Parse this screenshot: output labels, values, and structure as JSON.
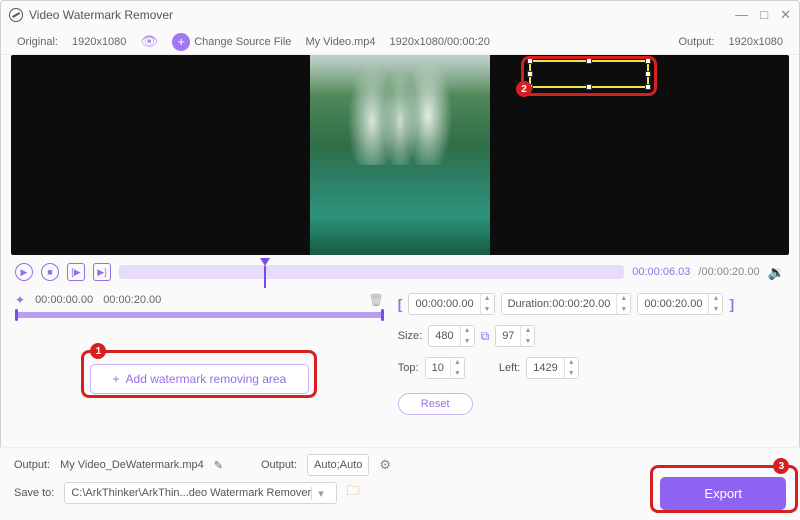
{
  "app_title": "Video Watermark Remover",
  "window": {
    "min": "—",
    "max": "□",
    "close": "✕"
  },
  "infobar": {
    "original_label": "Original:",
    "original_res": "1920x1080",
    "change_source": "Change Source File",
    "filename": "My Video.mp4",
    "src_info": "1920x1080/00:00:20",
    "output_label": "Output:",
    "output_res": "1920x1080"
  },
  "transport": {
    "current": "00:00:06.03",
    "duration": "/00:00:20.00"
  },
  "segment": {
    "start": "00:00:00.00",
    "end": "00:00:20.00"
  },
  "add_area_label": "Add watermark removing area",
  "region": {
    "range_start": "00:00:00.00",
    "duration_label": "Duration:00:00:20.00",
    "range_end": "00:00:20.00",
    "size_label": "Size:",
    "width": "480",
    "height": "97",
    "top_label": "Top:",
    "top": "10",
    "left_label": "Left:",
    "left": "1429",
    "reset": "Reset"
  },
  "bottom": {
    "output_label": "Output:",
    "output_name": "My Video_DeWatermark.mp4",
    "output2_label": "Output:",
    "output2_value": "Auto;Auto",
    "save_label": "Save to:",
    "save_path": "C:\\ArkThinker\\ArkThin...deo Watermark Remover"
  },
  "export_label": "Export",
  "callouts": {
    "c1": "1",
    "c2": "2",
    "c3": "3"
  }
}
